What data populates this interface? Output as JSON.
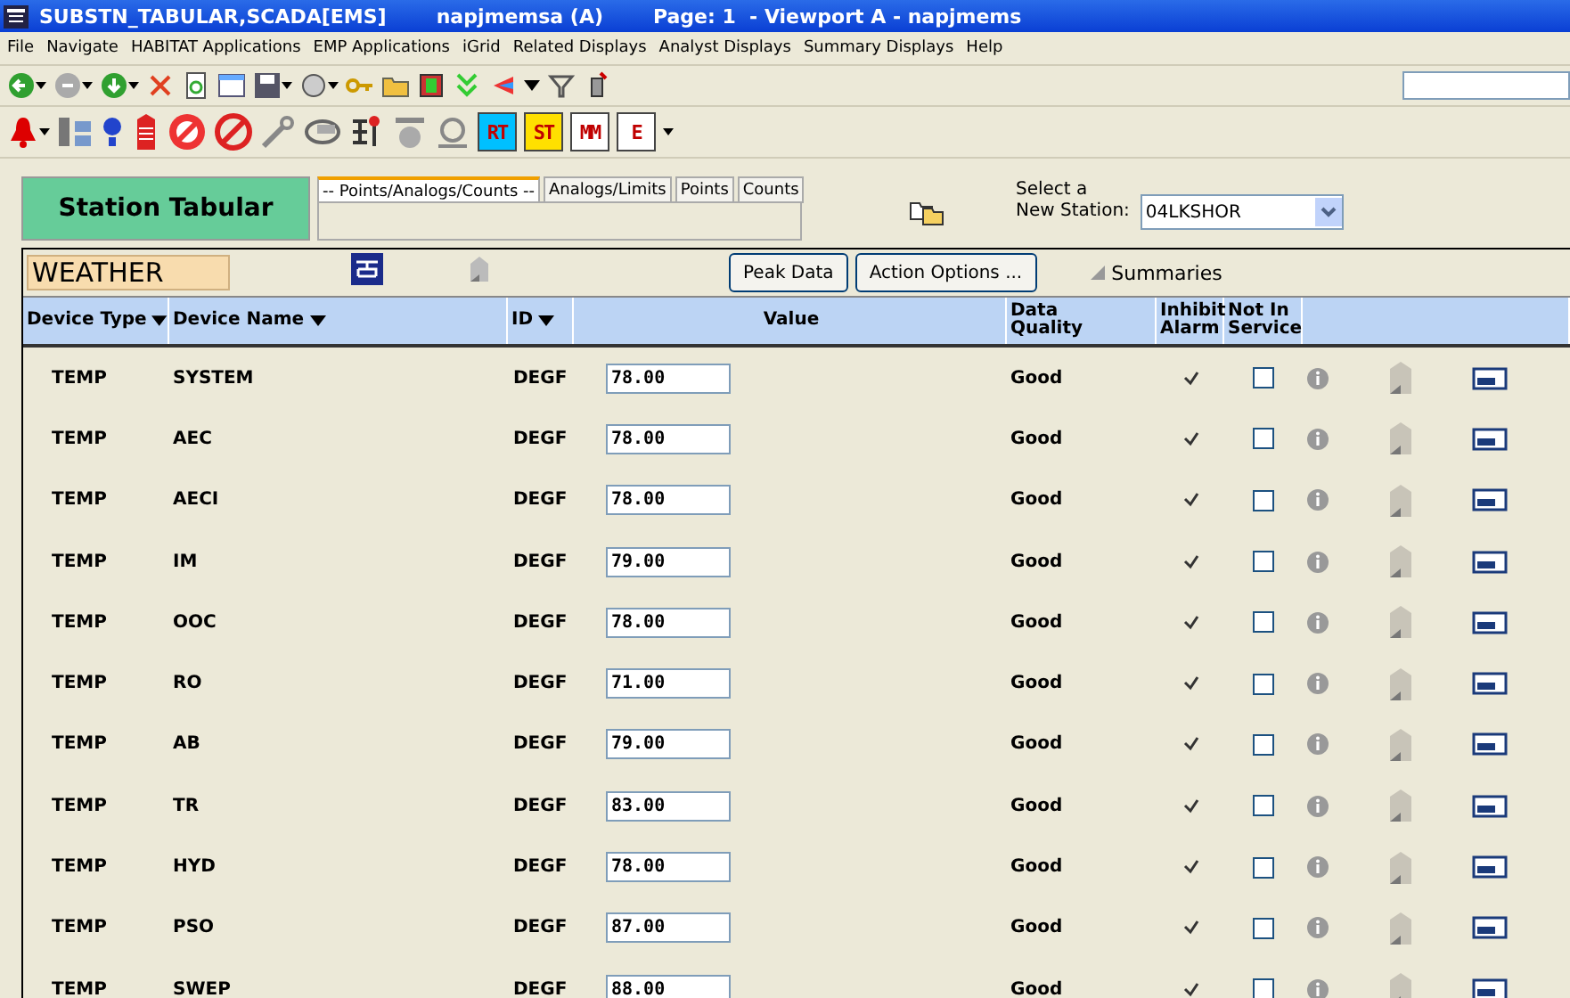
{
  "window": {
    "title": "SUBSTN_TABULAR,SCADA[EMS]",
    "user": "napjmemsa (A)",
    "page": "Page: 1  - Viewport A - napjmems"
  },
  "menu": [
    "File",
    "Navigate",
    "HABITAT Applications",
    "EMP Applications",
    "iGrid",
    "Related Displays",
    "Analyst Displays",
    "Summary Displays",
    "Help"
  ],
  "toolbar_badges": [
    {
      "label": "RT",
      "color": "#00c0ff"
    },
    {
      "label": "ST",
      "color": "#ffe000"
    },
    {
      "label": "MM",
      "color": "#ffffff"
    },
    {
      "label": "E",
      "color": "#ffffff"
    }
  ],
  "header": {
    "title": "Station Tabular",
    "tabs": [
      {
        "label": "-- Points/Analogs/Counts --",
        "selected": true
      },
      {
        "label": "Analogs/Limits",
        "selected": false
      },
      {
        "label": "Points",
        "selected": false
      },
      {
        "label": "Counts",
        "selected": false
      }
    ],
    "station_label": "Select a\nNew Station:",
    "station": "04LKSHOR"
  },
  "section": {
    "name": "WEATHER",
    "buttons": [
      "Peak Data",
      "Action Options ..."
    ],
    "summaries": "Summaries"
  },
  "table": {
    "columns": [
      "Device Type",
      "Device Name",
      "ID",
      "Value",
      "Data\nQuality",
      "Inhibit\nAlarm",
      "Not In\nService"
    ],
    "rows": [
      {
        "type": "TEMP",
        "name": "SYSTEM",
        "id": "DEGF",
        "value": "78.00",
        "quality": "Good",
        "inhibit": true,
        "not_in_service": false
      },
      {
        "type": "TEMP",
        "name": "AEC",
        "id": "DEGF",
        "value": "78.00",
        "quality": "Good",
        "inhibit": true,
        "not_in_service": false
      },
      {
        "type": "TEMP",
        "name": "AECI",
        "id": "DEGF",
        "value": "78.00",
        "quality": "Good",
        "inhibit": true,
        "not_in_service": false
      },
      {
        "type": "TEMP",
        "name": "IM",
        "id": "DEGF",
        "value": "79.00",
        "quality": "Good",
        "inhibit": true,
        "not_in_service": false
      },
      {
        "type": "TEMP",
        "name": "OOC",
        "id": "DEGF",
        "value": "78.00",
        "quality": "Good",
        "inhibit": true,
        "not_in_service": false
      },
      {
        "type": "TEMP",
        "name": "RO",
        "id": "DEGF",
        "value": "71.00",
        "quality": "Good",
        "inhibit": true,
        "not_in_service": false
      },
      {
        "type": "TEMP",
        "name": "AB",
        "id": "DEGF",
        "value": "79.00",
        "quality": "Good",
        "inhibit": true,
        "not_in_service": false
      },
      {
        "type": "TEMP",
        "name": "TR",
        "id": "DEGF",
        "value": "83.00",
        "quality": "Good",
        "inhibit": true,
        "not_in_service": false
      },
      {
        "type": "TEMP",
        "name": "HYD",
        "id": "DEGF",
        "value": "78.00",
        "quality": "Good",
        "inhibit": true,
        "not_in_service": false
      },
      {
        "type": "TEMP",
        "name": "PSO",
        "id": "DEGF",
        "value": "87.00",
        "quality": "Good",
        "inhibit": true,
        "not_in_service": false
      },
      {
        "type": "TEMP",
        "name": "SWEP",
        "id": "DEGF",
        "value": "88.00",
        "quality": "Good",
        "inhibit": true,
        "not_in_service": false
      }
    ]
  }
}
